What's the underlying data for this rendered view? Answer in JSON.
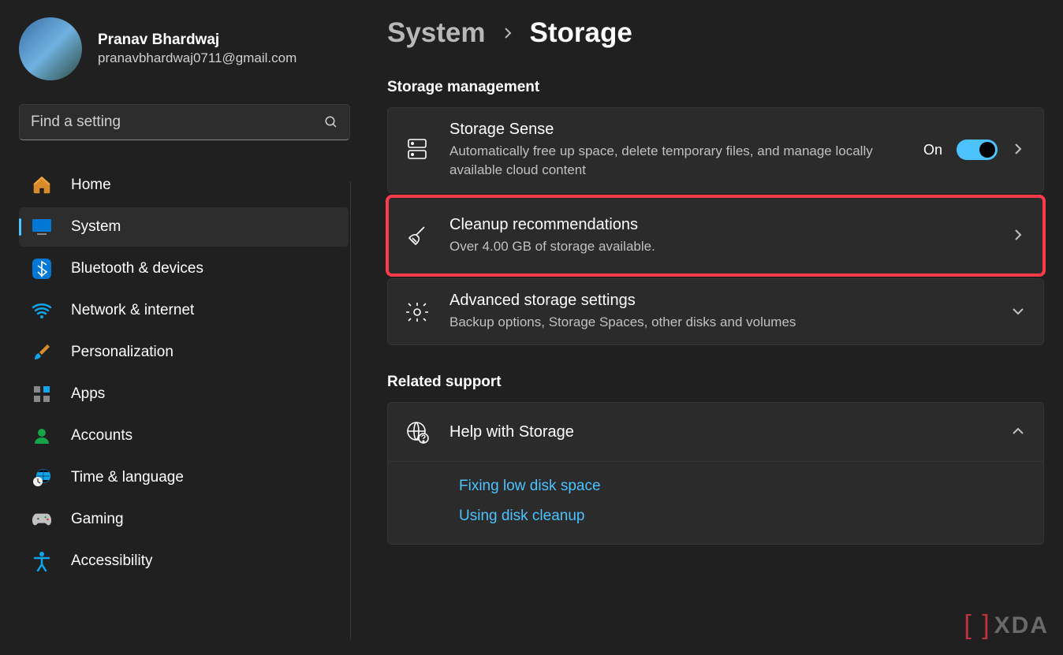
{
  "profile": {
    "name": "Pranav Bhardwaj",
    "email": "pranavbhardwaj0711@gmail.com"
  },
  "search": {
    "placeholder": "Find a setting"
  },
  "nav": {
    "items": [
      {
        "id": "home",
        "label": "Home",
        "active": false
      },
      {
        "id": "system",
        "label": "System",
        "active": true
      },
      {
        "id": "bluetooth",
        "label": "Bluetooth & devices",
        "active": false
      },
      {
        "id": "network",
        "label": "Network & internet",
        "active": false
      },
      {
        "id": "personalization",
        "label": "Personalization",
        "active": false
      },
      {
        "id": "apps",
        "label": "Apps",
        "active": false
      },
      {
        "id": "accounts",
        "label": "Accounts",
        "active": false
      },
      {
        "id": "time",
        "label": "Time & language",
        "active": false
      },
      {
        "id": "gaming",
        "label": "Gaming",
        "active": false
      },
      {
        "id": "accessibility",
        "label": "Accessibility",
        "active": false
      }
    ]
  },
  "breadcrumb": {
    "parent": "System",
    "current": "Storage"
  },
  "sections": {
    "management": {
      "title": "Storage management",
      "storage_sense": {
        "title": "Storage Sense",
        "subtitle": "Automatically free up space, delete temporary files, and manage locally available cloud content",
        "toggle_label": "On",
        "toggle_on": true
      },
      "cleanup": {
        "title": "Cleanup recommendations",
        "subtitle": "Over 4.00 GB of storage available."
      },
      "advanced": {
        "title": "Advanced storage settings",
        "subtitle": "Backup options, Storage Spaces, other disks and volumes"
      }
    },
    "support": {
      "title": "Related support",
      "help_title": "Help with Storage",
      "links": [
        "Fixing low disk space",
        "Using disk cleanup"
      ]
    }
  },
  "watermark": "XDA"
}
